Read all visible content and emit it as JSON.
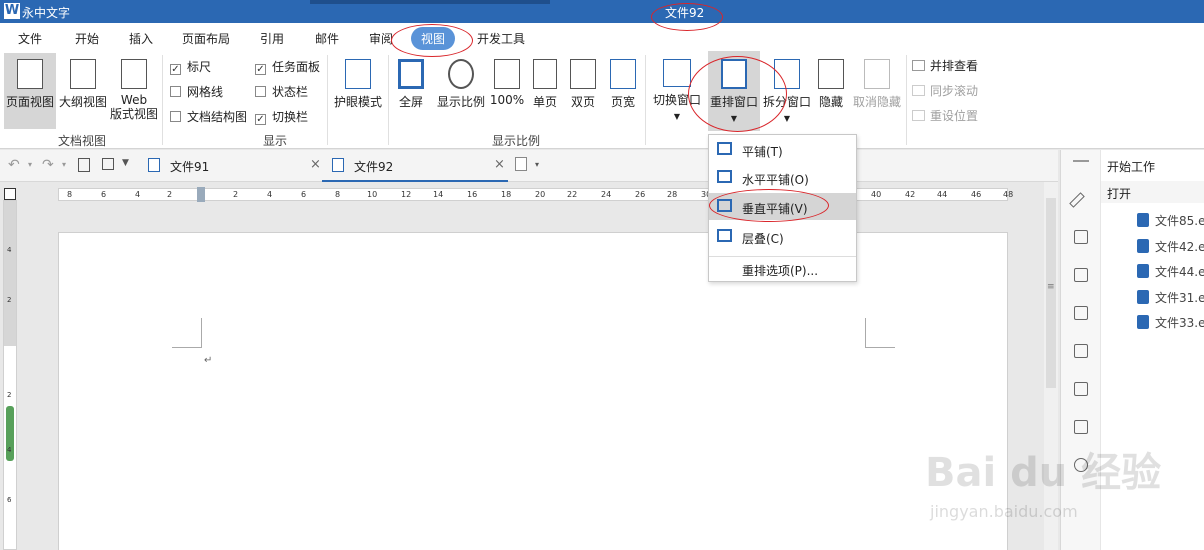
{
  "titlebar": {
    "logo": "W",
    "app_name": "永中文字",
    "doc_title": "文件92"
  },
  "menu": {
    "items": [
      "文件",
      "开始",
      "插入",
      "页面布局",
      "引用",
      "邮件",
      "审阅",
      "视图",
      "开发工具"
    ],
    "active": "视图"
  },
  "ribbon": {
    "doc_view": {
      "label": "文档视图",
      "buttons": [
        "页面视图",
        "大纲视图",
        "Web",
        "版式视图"
      ]
    },
    "display": {
      "label": "显示",
      "checkboxes": [
        {
          "label": "标尺",
          "checked": true
        },
        {
          "label": "网格线",
          "checked": false
        },
        {
          "label": "文档结构图",
          "checked": false
        },
        {
          "label": "任务面板",
          "checked": true
        },
        {
          "label": "状态栏",
          "checked": false
        },
        {
          "label": "切换栏",
          "checked": true
        }
      ]
    },
    "eye_mode": "护眼模式",
    "zoom": {
      "label": "显示比例",
      "buttons": [
        "全屏",
        "显示比例",
        "100%",
        "单页",
        "双页",
        "页宽"
      ]
    },
    "window": {
      "buttons": [
        "切换窗口",
        "重排窗口",
        "拆分窗口",
        "隐藏",
        "取消隐藏"
      ]
    },
    "side": {
      "items": [
        "并排查看",
        "同步滚动",
        "重设位置"
      ]
    }
  },
  "tabs": {
    "items": [
      "文件91",
      "文件92"
    ],
    "active": "文件92"
  },
  "ruler": {
    "labels": [
      "8",
      "6",
      "4",
      "2",
      "2",
      "4",
      "6",
      "8",
      "10",
      "12",
      "14",
      "16",
      "18",
      "20",
      "22",
      "24",
      "26",
      "28",
      "30",
      "40",
      "42",
      "44",
      "46",
      "48"
    ]
  },
  "vruler": {
    "labels": [
      "4",
      "2",
      "2",
      "4",
      "6"
    ]
  },
  "dropdown": {
    "items": [
      {
        "label": "平铺(T)"
      },
      {
        "label": "水平平铺(O)"
      },
      {
        "label": "垂直平铺(V)",
        "highlighted": true
      },
      {
        "label": "层叠(C)"
      },
      {
        "label": "重排选项(P)..."
      }
    ]
  },
  "task_pane": {
    "title": "开始工作",
    "open": "打开",
    "recent": [
      "文件85.e",
      "文件42.e",
      "文件44.e",
      "文件31.e",
      "文件33.e"
    ]
  },
  "watermark": {
    "line1": "Bai du 经验",
    "line2": "jingyan.baidu.com"
  },
  "colors": {
    "title_bg": "#2b68b3",
    "accent": "#5a93d8",
    "annotation": "#d9262b"
  }
}
